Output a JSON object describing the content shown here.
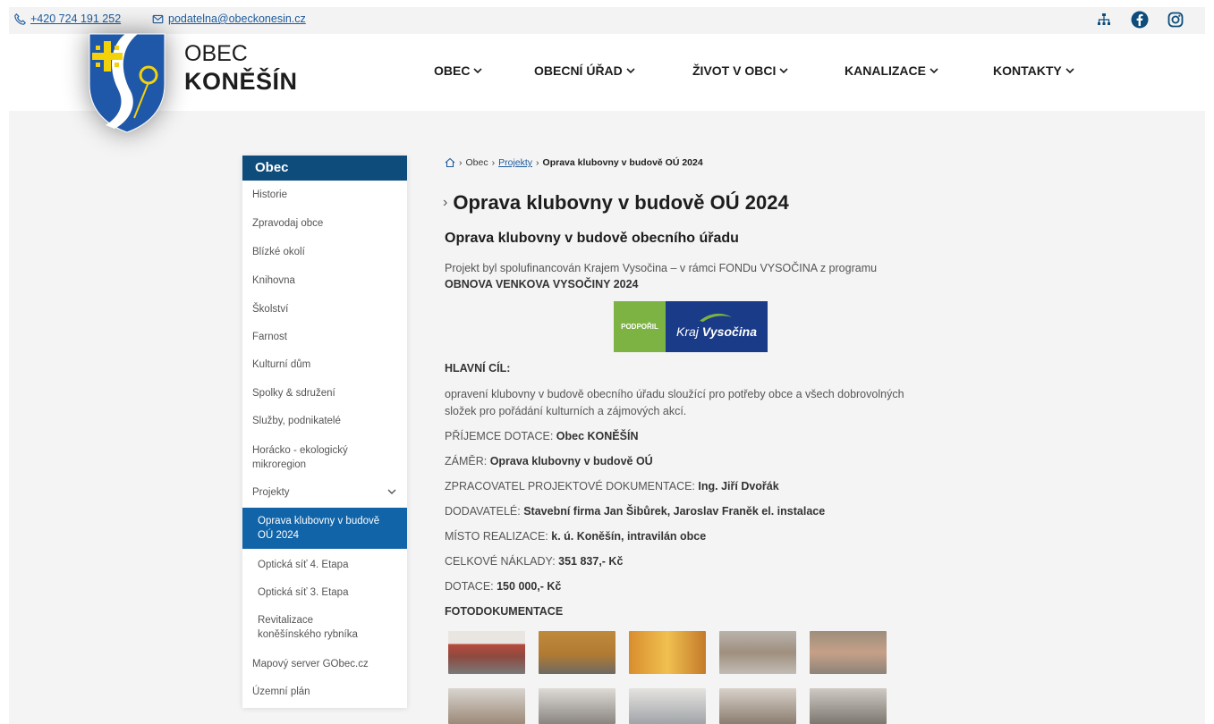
{
  "topbar": {
    "phone": "+420 724 191 252",
    "email": "podatelna@obeckonesin.cz",
    "icons": [
      "sitemap-icon",
      "facebook-icon",
      "instagram-icon"
    ]
  },
  "brand": {
    "line1": "OBEC",
    "line2": "KONĚŠÍN"
  },
  "nav": [
    {
      "label": "OBEC"
    },
    {
      "label": "OBECNÍ ÚŘAD"
    },
    {
      "label": "ŽIVOT V OBCI"
    },
    {
      "label": "KANALIZACE"
    },
    {
      "label": "KONTAKTY"
    }
  ],
  "sidebar": {
    "title": "Obec",
    "items": [
      {
        "label": "Historie"
      },
      {
        "label": "Zpravodaj obce"
      },
      {
        "label": "Blízké okolí"
      },
      {
        "label": "Knihovna"
      },
      {
        "label": "Školství"
      },
      {
        "label": "Farnost"
      },
      {
        "label": "Kulturní dům"
      },
      {
        "label": "Spolky & sdružení"
      },
      {
        "label": "Služby, podnikatelé"
      },
      {
        "label": "Horácko - ekologický mikroregion"
      },
      {
        "label": "Projekty"
      },
      {
        "label": "Oprava klubovny v budově OÚ 2024"
      },
      {
        "label": "Optická síť 4. Etapa"
      },
      {
        "label": "Optická síť 3. Etapa"
      },
      {
        "label": "Revitalizace koněšínského rybníka"
      },
      {
        "label": "Mapový server GObec.cz"
      },
      {
        "label": "Územní plán"
      }
    ]
  },
  "breadcrumb": {
    "home": "home-icon",
    "items": [
      "Obec",
      "Projekty",
      "Oprava klubovny v budově OÚ 2024"
    ]
  },
  "page": {
    "title": "Oprava klubovny v budově OÚ 2024",
    "subtitle": "Oprava klubovny v budově obecního úřadu",
    "intro": "Projekt byl spolufinancován Krajem Vysočina – v rámci FONDu VYSOČINA z programu",
    "program": "OBNOVA VENKOVA VYSOČINY 2024",
    "badge_left": "PODPOŘIL",
    "badge_right_1": "Kraj",
    "badge_right_2": "Vysočina",
    "goal_heading": "HLAVNÍ CÍL:",
    "goal_text_1": "opravení klubovny v budově obecního úřadu sloužící pro potřeby obce a všech dobrovolných",
    "goal_text_2": "složek pro pořádání kulturních a zájmových akcí.",
    "rows": [
      {
        "label": "PŘÍJEMCE DOTACE: ",
        "value": "Obec KONĚŠÍN"
      },
      {
        "label": "ZÁMĚR: ",
        "value": "Oprava klubovny v budově OÚ"
      },
      {
        "label": "ZPRACOVATEL PROJEKTOVÉ DOKUMENTACE: ",
        "value": "Ing. Jiří Dvořák"
      },
      {
        "label": "DODAVATELÉ: ",
        "value": "Stavební firma Jan Šibůrek, Jaroslav Franěk el. instalace"
      },
      {
        "label": "MÍSTO REALIZACE: ",
        "value": "k. ú. Koněšín, intravilán obce"
      },
      {
        "label": "CELKOVÉ NÁKLADY: ",
        "value": "351 837,- Kč"
      },
      {
        "label": "DOTACE: ",
        "value": "150 000,- Kč"
      }
    ],
    "photo_heading": "FOTODOKUMENTACE"
  },
  "colors": {
    "navy": "#0d4c7b",
    "active": "#1164a8",
    "link": "#1c5a9c",
    "badge_green": "#7cb342",
    "badge_blue": "#1a3b87"
  }
}
